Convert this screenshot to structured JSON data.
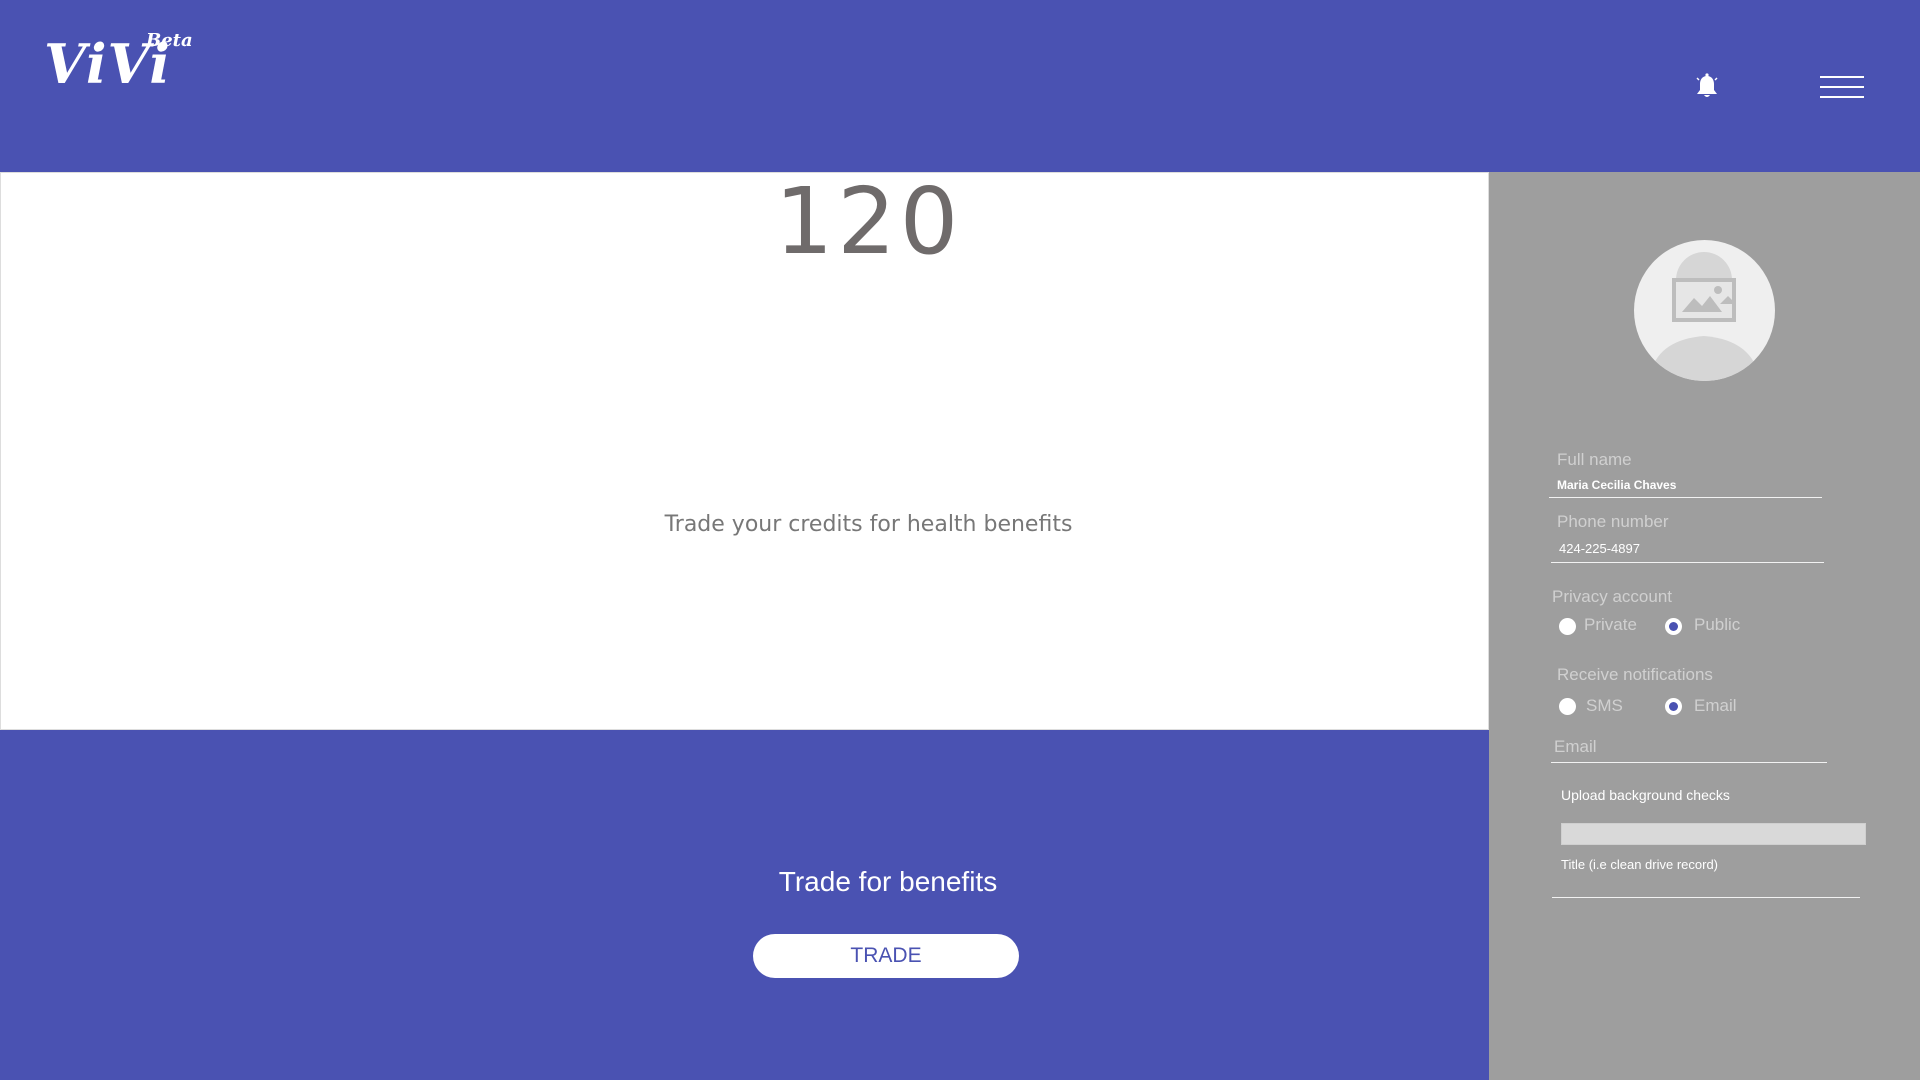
{
  "header": {
    "logo": "ViVi",
    "badge": "Beta",
    "icons": [
      "bell-icon",
      "hamburger-menu-icon"
    ]
  },
  "credits": {
    "value": "120",
    "caption": "Trade your credits for health benefits"
  },
  "trade": {
    "title": "Trade for benefits",
    "button_label": "TRADE"
  },
  "profile": {
    "avatar_icon": "avatar-placeholder-icon",
    "full_name_label": "Full name",
    "full_name_value": "Maria Cecilia Chaves",
    "phone_label": "Phone number",
    "phone_value": "424-225-4897",
    "privacy_label": "Privacy account",
    "privacy_options": [
      "Private",
      "Public"
    ],
    "privacy_selected": "Public",
    "notifications_label": "Receive notifications",
    "notification_options": [
      "SMS",
      "Email"
    ],
    "notification_selected": "Email",
    "email_placeholder": "Email",
    "upload_label": "Upload background checks",
    "title_placeholder": "Title (i.e clean drive record)"
  },
  "colors": {
    "brand": "#4a52b2",
    "panel": "#9e9e9e",
    "card": "#ffffff"
  }
}
